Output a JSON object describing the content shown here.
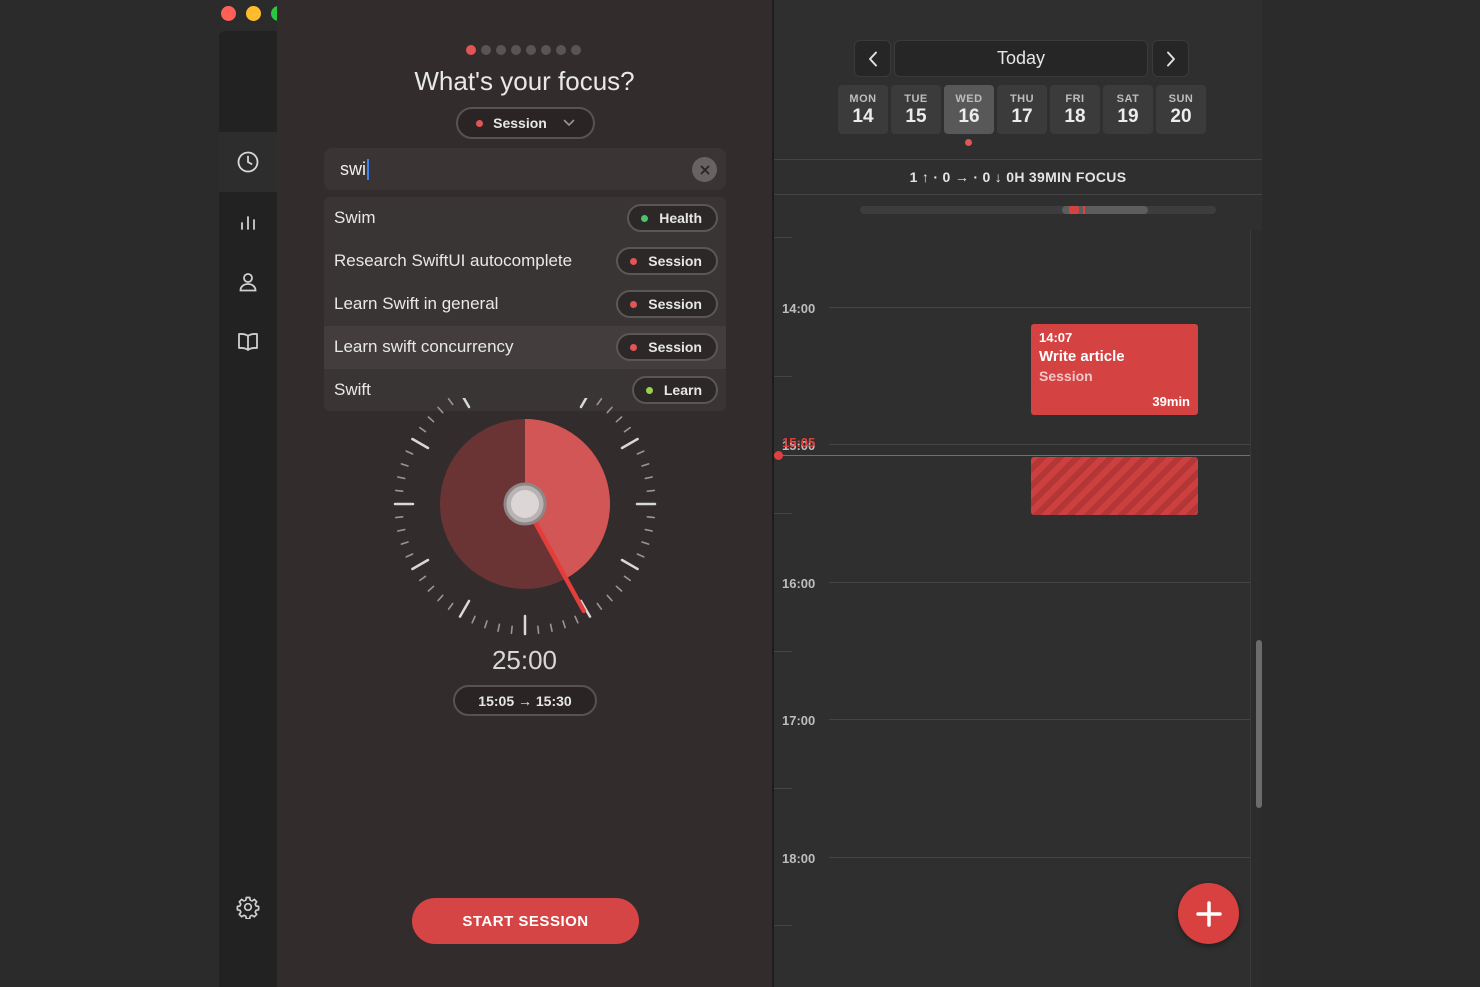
{
  "window": {
    "traffic_lights": {
      "close": "#ff5f57",
      "minimize": "#febc2e",
      "zoom": "#28c840"
    }
  },
  "sidebar": {
    "items": [
      {
        "icon": "clock-icon",
        "active": true
      },
      {
        "icon": "bar-chart-icon",
        "active": false
      },
      {
        "icon": "person-icon",
        "active": false
      },
      {
        "icon": "book-icon",
        "active": false
      }
    ],
    "settings_icon": "gear-icon"
  },
  "focus": {
    "page_dots": {
      "count": 8,
      "active_index": 0
    },
    "title": "What's your focus?",
    "category_select": {
      "label": "Session",
      "color": "#e05656"
    },
    "search": {
      "value": "swi",
      "placeholder": ""
    },
    "results": [
      {
        "label": "Swim",
        "tag": "Health",
        "tag_color": "#4cc36a"
      },
      {
        "label": "Research SwiftUI autocomplete",
        "tag": "Session",
        "tag_color": "#e05656"
      },
      {
        "label": "Learn Swift in general",
        "tag": "Session",
        "tag_color": "#e05656"
      },
      {
        "label": "Learn swift concurrency",
        "tag": "Session",
        "tag_color": "#e05656"
      },
      {
        "label": "Swift",
        "tag": "Learn",
        "tag_color": "#9ad04a"
      }
    ],
    "timer": {
      "remaining": "25:00",
      "range": "15:05 → 15:30",
      "progress_fraction": 0.42
    },
    "start_button": "START SESSION",
    "accent": "#d64545"
  },
  "calendar": {
    "today_label": "Today",
    "days": [
      {
        "name": "MON",
        "date": "14"
      },
      {
        "name": "TUE",
        "date": "15"
      },
      {
        "name": "WED",
        "date": "16",
        "selected": true
      },
      {
        "name": "THU",
        "date": "17"
      },
      {
        "name": "FRI",
        "date": "18"
      },
      {
        "name": "SAT",
        "date": "19"
      },
      {
        "name": "SUN",
        "date": "20"
      }
    ],
    "summary": "1 ↑ · 0 → · 0 ↓   0H 39MIN FOCUS",
    "hours": [
      "14:00",
      "15:00",
      "16:00",
      "17:00",
      "18:00"
    ],
    "now_time": "15:05",
    "event": {
      "time": "14:07",
      "title": "Write article",
      "category": "Session",
      "duration": "39min"
    },
    "event_color": "#d54242"
  }
}
